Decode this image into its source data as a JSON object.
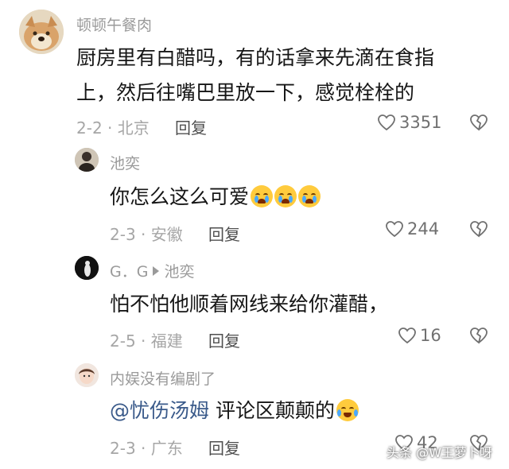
{
  "comments": [
    {
      "username": "顿顿午餐肉",
      "text_lines": [
        "厨房里有白醋吗，有的话拿来先滴在食指",
        "上，然后往嘴巴里放一下，感觉栓栓的"
      ],
      "meta": "2-2 · 北京",
      "reply_label": "回复",
      "likes": "3351",
      "avatar_icon": "dog-avatar"
    },
    {
      "username": "池奕",
      "text": "你怎么这么可爱",
      "emoji_count": 3,
      "emoji_icon": "crying-face-emoji",
      "meta": "2-3 · 安徽",
      "reply_label": "回复",
      "likes": "244",
      "avatar_icon": "person-avatar"
    },
    {
      "username": "G．G",
      "reply_to": "池奕",
      "text": "怕不怕他顺着网线来给你灌醋，",
      "meta": "2-5 · 福建",
      "reply_label": "回复",
      "likes": "16",
      "avatar_icon": "dark-avatar"
    },
    {
      "username": "内娱没有编剧了",
      "mention": "@忧伤汤姆",
      "text": " 评论区颠颠的",
      "emoji_icon": "laughing-crying-emoji",
      "meta": "2-3 · 广东",
      "reply_label": "回复",
      "likes": "42",
      "avatar_icon": "girl-avatar"
    }
  ],
  "watermark": "头条 @W王萝卜呀",
  "colors": {
    "text": "#161616",
    "username": "#9a9a9a",
    "meta": "#a6a6a6",
    "mention": "#3a5a8a"
  }
}
